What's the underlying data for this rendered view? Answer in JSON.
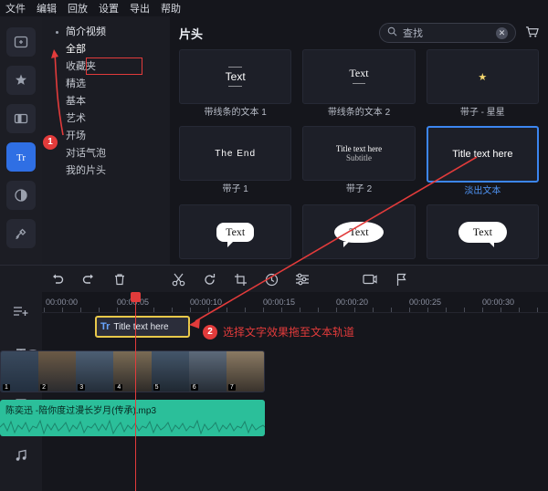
{
  "menu": {
    "items": [
      "文件",
      "编辑",
      "回放",
      "设置",
      "导出",
      "帮助"
    ]
  },
  "rail": {
    "items": [
      {
        "name": "media-icon",
        "glyph": "▣"
      },
      {
        "name": "effects-icon",
        "glyph": "✦"
      },
      {
        "name": "transition-icon",
        "glyph": "◧"
      },
      {
        "name": "text-icon",
        "glyph": "Tr"
      },
      {
        "name": "audio-icon",
        "glyph": "◔"
      },
      {
        "name": "tools-icon",
        "glyph": "⚒"
      }
    ],
    "active_index": 3
  },
  "categories": {
    "items": [
      {
        "label": "简介视频",
        "bullet": true,
        "selected": false
      },
      {
        "label": "全部",
        "bullet": false,
        "selected": true
      },
      {
        "label": "收藏夹",
        "bullet": false,
        "selected": false
      },
      {
        "label": "精选",
        "bullet": false,
        "selected": false
      },
      {
        "label": "基本",
        "bullet": false,
        "selected": false
      },
      {
        "label": "艺术",
        "bullet": false,
        "selected": false
      },
      {
        "label": "开场",
        "bullet": false,
        "selected": false
      },
      {
        "label": "对话气泡",
        "bullet": false,
        "selected": false
      },
      {
        "label": "我的片头",
        "bullet": false,
        "selected": false
      }
    ]
  },
  "library": {
    "title": "片头",
    "search": {
      "value": "查找",
      "placeholder": "查找",
      "icon": "search-icon",
      "clear": "✕"
    },
    "cart_icon": "cart-icon",
    "items": [
      {
        "caption": "带线条的文本 1",
        "style": "lined1",
        "text": "Text",
        "selected": false
      },
      {
        "caption": "带线条的文本 2",
        "style": "lined2",
        "text": "Text",
        "selected": false
      },
      {
        "caption": "带子 - 星星",
        "style": "star",
        "text": "★",
        "selected": false
      },
      {
        "caption": "带子 1",
        "style": "ribbon",
        "text": "The End",
        "selected": false
      },
      {
        "caption": "带子 2",
        "style": "ribbon2",
        "text": "Title text here",
        "subtext": "Subtitle",
        "selected": false
      },
      {
        "caption": "淡出文本",
        "style": "fade",
        "text": "Title text here",
        "selected": true
      },
      {
        "caption": "",
        "style": "bubble1",
        "text": "Text",
        "selected": false
      },
      {
        "caption": "",
        "style": "bubble2",
        "text": "Text",
        "selected": false
      },
      {
        "caption": "",
        "style": "bubble3",
        "text": "Text",
        "selected": false
      }
    ]
  },
  "toolbar": {
    "buttons": [
      {
        "name": "undo-button",
        "glyph": "↶"
      },
      {
        "name": "redo-button",
        "glyph": "↷"
      },
      {
        "name": "delete-button",
        "glyph": "🗑"
      },
      {
        "name": "split-button",
        "glyph": "✂"
      },
      {
        "name": "rotate-button",
        "glyph": "↻"
      },
      {
        "name": "crop-button",
        "glyph": "⌗"
      },
      {
        "name": "speed-button",
        "glyph": "◑"
      },
      {
        "name": "color-button",
        "glyph": "≡"
      },
      {
        "name": "snapshot-button",
        "glyph": "❏"
      },
      {
        "name": "marker-button",
        "glyph": "⚑"
      }
    ]
  },
  "timeline": {
    "rail": [
      {
        "name": "add-track-icon",
        "glyph": "≡+"
      },
      {
        "name": "text-track-icon",
        "glyph": "T"
      },
      {
        "name": "video-track-icon",
        "glyph": "▦"
      },
      {
        "name": "audio-track-icon",
        "glyph": "♪"
      }
    ],
    "ruler_ticks": [
      "00:00:00",
      "00:00:05",
      "00:00:10",
      "00:00:15",
      "00:00:20",
      "00:00:25",
      "00:00:30"
    ],
    "text_clip": {
      "label": "Title text here",
      "icon": "Tr"
    },
    "audio_clip": {
      "label": "陈奕迅 -陪你度过漫长岁月(传承).mp3"
    },
    "video_clip_numbers": [
      "1",
      "2",
      "3",
      "4",
      "5",
      "6",
      "7"
    ]
  },
  "annotations": [
    {
      "id": "1",
      "text": ""
    },
    {
      "id": "2",
      "text": "选择文字效果拖至文本轨道"
    }
  ],
  "colors": {
    "accent": "#2f6fe4",
    "annotation": "#e23b3b",
    "selected_border": "#3c86f0",
    "audio_clip": "#2bbf9a",
    "clip_highlight": "#e8c84a"
  }
}
